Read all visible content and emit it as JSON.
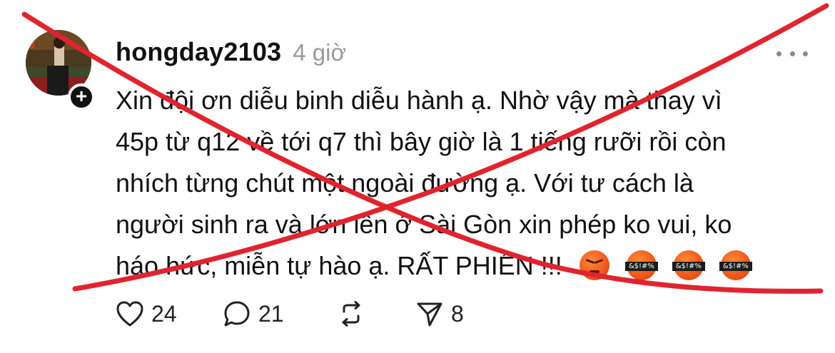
{
  "post": {
    "username": "hongday2103",
    "timestamp": "4 giờ",
    "text_lines": [
      "Xin đội ơn diễu binh diễu hành ạ. Nhờ vậy mà thay vì",
      "45p từ q12 về tới q7 thì bây giờ là 1 tiếng rưỡi rồi còn",
      "nhích từng chút một ngoài đường ạ. Với tư cách là",
      "người sinh ra và lớn lên ở Sài Gòn xin phép ko vui, ko",
      "háo hức, miễn tự hào ạ. RẤT PHIỀN !!!"
    ],
    "emoji_labels": [
      "&$!#%",
      "&$!#%",
      "&$!#%"
    ],
    "follow_symbol": "+",
    "actions": {
      "likes": "24",
      "comments": "21",
      "shares": "8"
    }
  },
  "icons": {
    "more": "more-horizontal-icon",
    "like": "heart-icon",
    "comment": "comment-bubble-icon",
    "repost": "repost-icon",
    "share": "send-icon"
  },
  "colors": {
    "overlay_cross": "#e0242f",
    "timestamp": "#9a9a9a",
    "text": "#111111",
    "badge": "#111111"
  }
}
